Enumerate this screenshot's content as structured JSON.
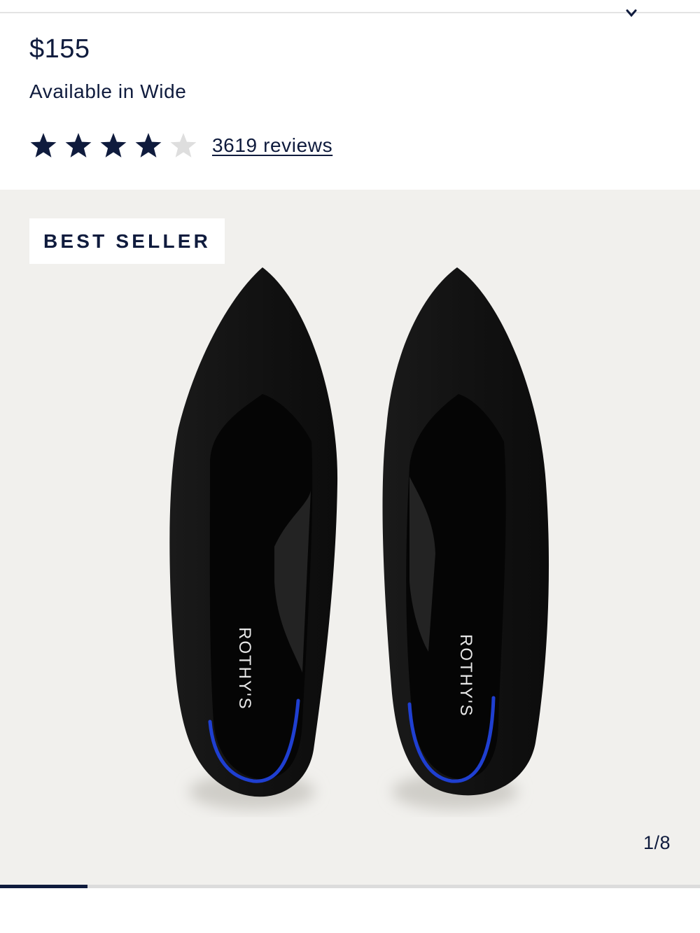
{
  "product": {
    "price": "$155",
    "width_note": "Available in Wide",
    "rating": {
      "value": 4,
      "max": 5
    },
    "reviews_label": "3619 reviews"
  },
  "gallery": {
    "badge": "BEST SELLER",
    "brand_insole": "ROTHY'S",
    "counter": "1/8",
    "current_image": 1,
    "total_images": 8,
    "progress_fraction": 0.125
  },
  "colors": {
    "navy": "#0f1b3d",
    "star_empty": "#dedede",
    "gallery_bg": "#f1f0ed",
    "accent_blue": "#1f3fd1"
  },
  "icons": {
    "star": "star-icon",
    "chevron": "chevron-down-icon"
  }
}
